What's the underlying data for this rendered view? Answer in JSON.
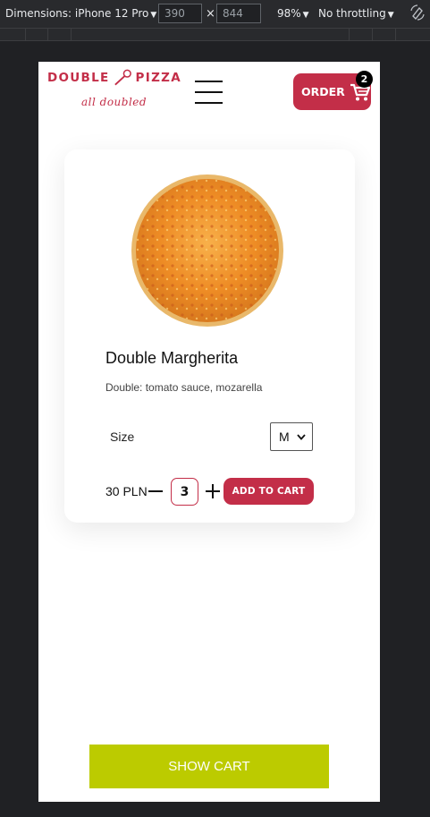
{
  "devtools": {
    "dimensions_label": "Dimensions: iPhone 12 Pro",
    "width_value": "390",
    "height_value": "844",
    "times": "×",
    "zoom": "98%",
    "throttling": "No throttling",
    "caret": "▼"
  },
  "header": {
    "brand_left": "DOUBLE",
    "brand_right": "PIZZA",
    "tagline": "all doubled",
    "order_label": "ORDER",
    "cart_count": "2"
  },
  "product": {
    "name": "Double Margherita",
    "description": "Double: tomato sauce, mozarella",
    "size_label": "Size",
    "size_value": "M",
    "price": "30 PLN",
    "quantity": "3",
    "add_label": "ADD TO CART"
  },
  "footer": {
    "show_cart_label": "SHOW CART"
  },
  "colors": {
    "brand": "#c32e48",
    "show_cart": "#bccb00"
  }
}
